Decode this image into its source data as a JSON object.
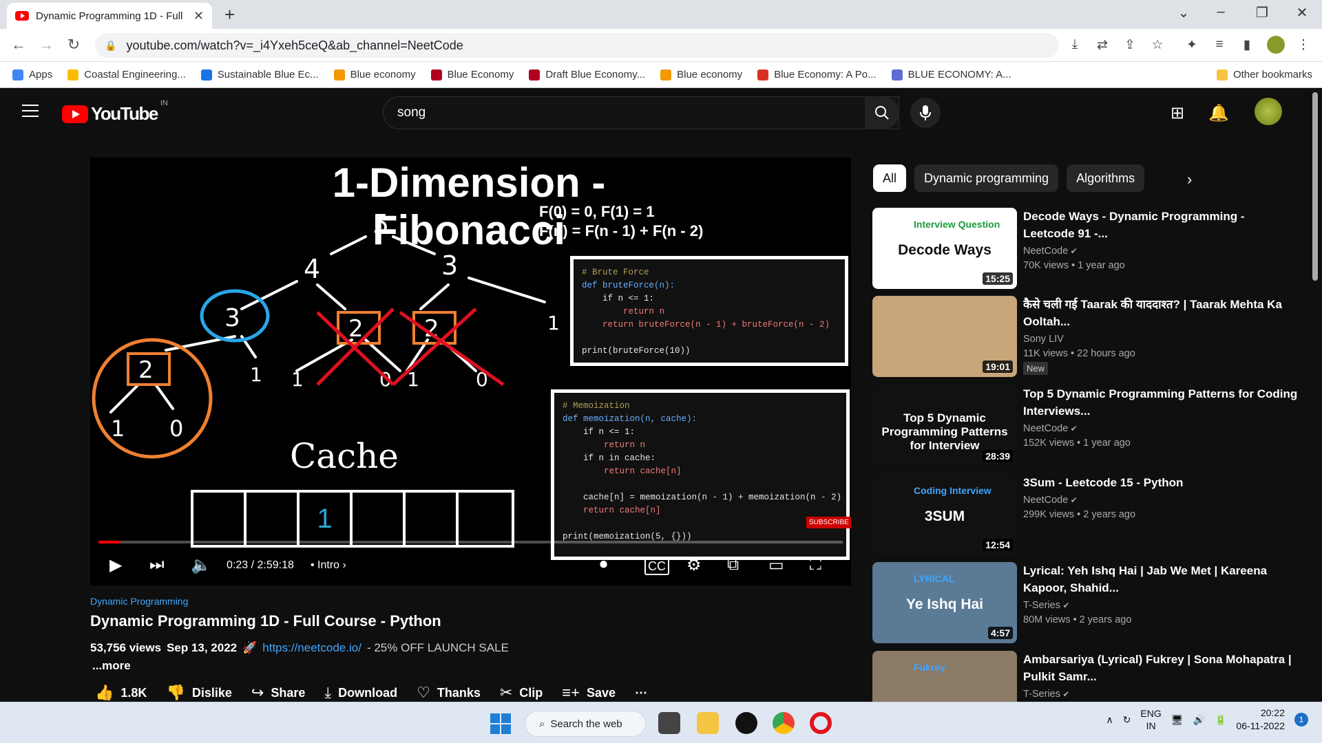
{
  "browser": {
    "tab_title": "Dynamic Programming 1D - Full",
    "url": "youtube.com/watch?v=_i4Yxeh5ceQ&ab_channel=NeetCode",
    "bookmarks": [
      {
        "label": "Apps",
        "color": "#4285f4"
      },
      {
        "label": "Coastal Engineering...",
        "color": "#fbbc04"
      },
      {
        "label": "Sustainable Blue Ec...",
        "color": "#1a73e8"
      },
      {
        "label": "Blue economy",
        "color": "#f29900"
      },
      {
        "label": "Blue Economy",
        "color": "#b00020"
      },
      {
        "label": "Draft Blue Economy...",
        "color": "#b00020"
      },
      {
        "label": "Blue economy",
        "color": "#f29900"
      },
      {
        "label": "Blue Economy: A Po...",
        "color": "#d93025"
      },
      {
        "label": "BLUE ECONOMY: A...",
        "color": "#5f6ad6"
      }
    ],
    "other_bookmarks": "Other bookmarks"
  },
  "youtube": {
    "logo": "YouTube",
    "country_code": "IN",
    "search_value": "song"
  },
  "player": {
    "slide_title": "1-Dimension - Fibonacci",
    "formula_1": "F(0) = 0, F(1) = 1",
    "formula_2": "F(n) = F(n - 1) + F(n - 2)",
    "code_brute": [
      {
        "t": "# Brute Force",
        "c": "cm"
      },
      {
        "t": "def bruteForce(n):",
        "c": "kw"
      },
      {
        "t": "    if n <= 1:",
        "c": ""
      },
      {
        "t": "        return n",
        "c": "rt"
      },
      {
        "t": "    return bruteForce(n - 1) + bruteForce(n - 2)",
        "c": "rt"
      },
      {
        "t": "",
        "c": ""
      },
      {
        "t": "print(bruteForce(10))",
        "c": ""
      }
    ],
    "code_memo": [
      {
        "t": "# Memoization",
        "c": "cm"
      },
      {
        "t": "def memoization(n, cache):",
        "c": "kw"
      },
      {
        "t": "    if n <= 1:",
        "c": ""
      },
      {
        "t": "        return n",
        "c": "rt"
      },
      {
        "t": "    if n in cache:",
        "c": ""
      },
      {
        "t": "        return cache[n]",
        "c": "rt"
      },
      {
        "t": "",
        "c": ""
      },
      {
        "t": "    cache[n] = memoization(n - 1) + memoization(n - 2)",
        "c": ""
      },
      {
        "t": "    return cache[n]",
        "c": "rt"
      },
      {
        "t": "",
        "c": ""
      },
      {
        "t": "print(memoization(5, {}))",
        "c": ""
      }
    ],
    "cache_label": "Cache",
    "cache_values": [
      "",
      "",
      "1",
      "",
      "",
      ""
    ],
    "subscribe_badge": "SUBSCRIBE",
    "time": "0:23 / 2:59:18",
    "chapter": "Intro",
    "progress_fraction": 0.03
  },
  "video": {
    "channel_tag": "Dynamic Programming",
    "title": "Dynamic Programming 1D - Full Course - Python",
    "views": "53,756 views",
    "date": "Sep 13, 2022",
    "link": "https://neetcode.io/",
    "promo": "- 25% OFF LAUNCH SALE",
    "more": "...more",
    "actions": {
      "like": "1.8K",
      "dislike": "Dislike",
      "share": "Share",
      "download": "Download",
      "thanks": "Thanks",
      "clip": "Clip",
      "save": "Save"
    }
  },
  "chips": [
    "All",
    "Dynamic programming",
    "Algorithms"
  ],
  "recommendations": [
    {
      "title": "Decode Ways - Dynamic Programming - Leetcode 91 -...",
      "channel": "NeetCode",
      "meta": "70K views • 1 year ago",
      "duration": "15:25",
      "thumb_top": "Interview Question",
      "thumb_main": "Decode Ways",
      "thumb_bg": "#ffffff",
      "verified": true,
      "new": ""
    },
    {
      "title": "कैसे चली गई Taarak की याददाश्त? | Taarak Mehta Ka Ooltah...",
      "channel": "Sony LIV",
      "meta": "11K views • 22 hours ago",
      "duration": "19:01",
      "thumb_top": "",
      "thumb_main": "",
      "thumb_bg": "#c9a57a",
      "verified": false,
      "new": "New"
    },
    {
      "title": "Top 5 Dynamic Programming Patterns for Coding Interviews...",
      "channel": "NeetCode",
      "meta": "152K views • 1 year ago",
      "duration": "28:39",
      "thumb_top": "",
      "thumb_main": "Top 5 Dynamic Programming Patterns for Interview",
      "thumb_bg": "#111111",
      "verified": true,
      "new": ""
    },
    {
      "title": "3Sum - Leetcode 15 - Python",
      "channel": "NeetCode",
      "meta": "299K views • 2 years ago",
      "duration": "12:54",
      "thumb_top": "Coding Interview",
      "thumb_main": "3SUM",
      "thumb_bg": "#111111",
      "verified": true,
      "new": ""
    },
    {
      "title": "Lyrical: Yeh Ishq Hai | Jab We Met | Kareena Kapoor, Shahid...",
      "channel": "T-Series",
      "meta": "80M views • 2 years ago",
      "duration": "4:57",
      "thumb_top": "LYRICAL",
      "thumb_main": "Ye Ishq Hai",
      "thumb_bg": "#5b7a96",
      "verified": true,
      "new": ""
    },
    {
      "title": "Ambarsariya (Lyrical) Fukrey | Sona Mohapatra | Pulkit Samr...",
      "channel": "T-Series",
      "meta": "",
      "duration": "",
      "thumb_top": "Fukrey",
      "thumb_main": "",
      "thumb_bg": "#8a7a66",
      "verified": true,
      "new": ""
    }
  ],
  "taskbar": {
    "search_placeholder": "Search the web",
    "lang_1": "ENG",
    "lang_2": "IN",
    "time": "20:22",
    "date": "06-11-2022",
    "notifications": "1"
  }
}
